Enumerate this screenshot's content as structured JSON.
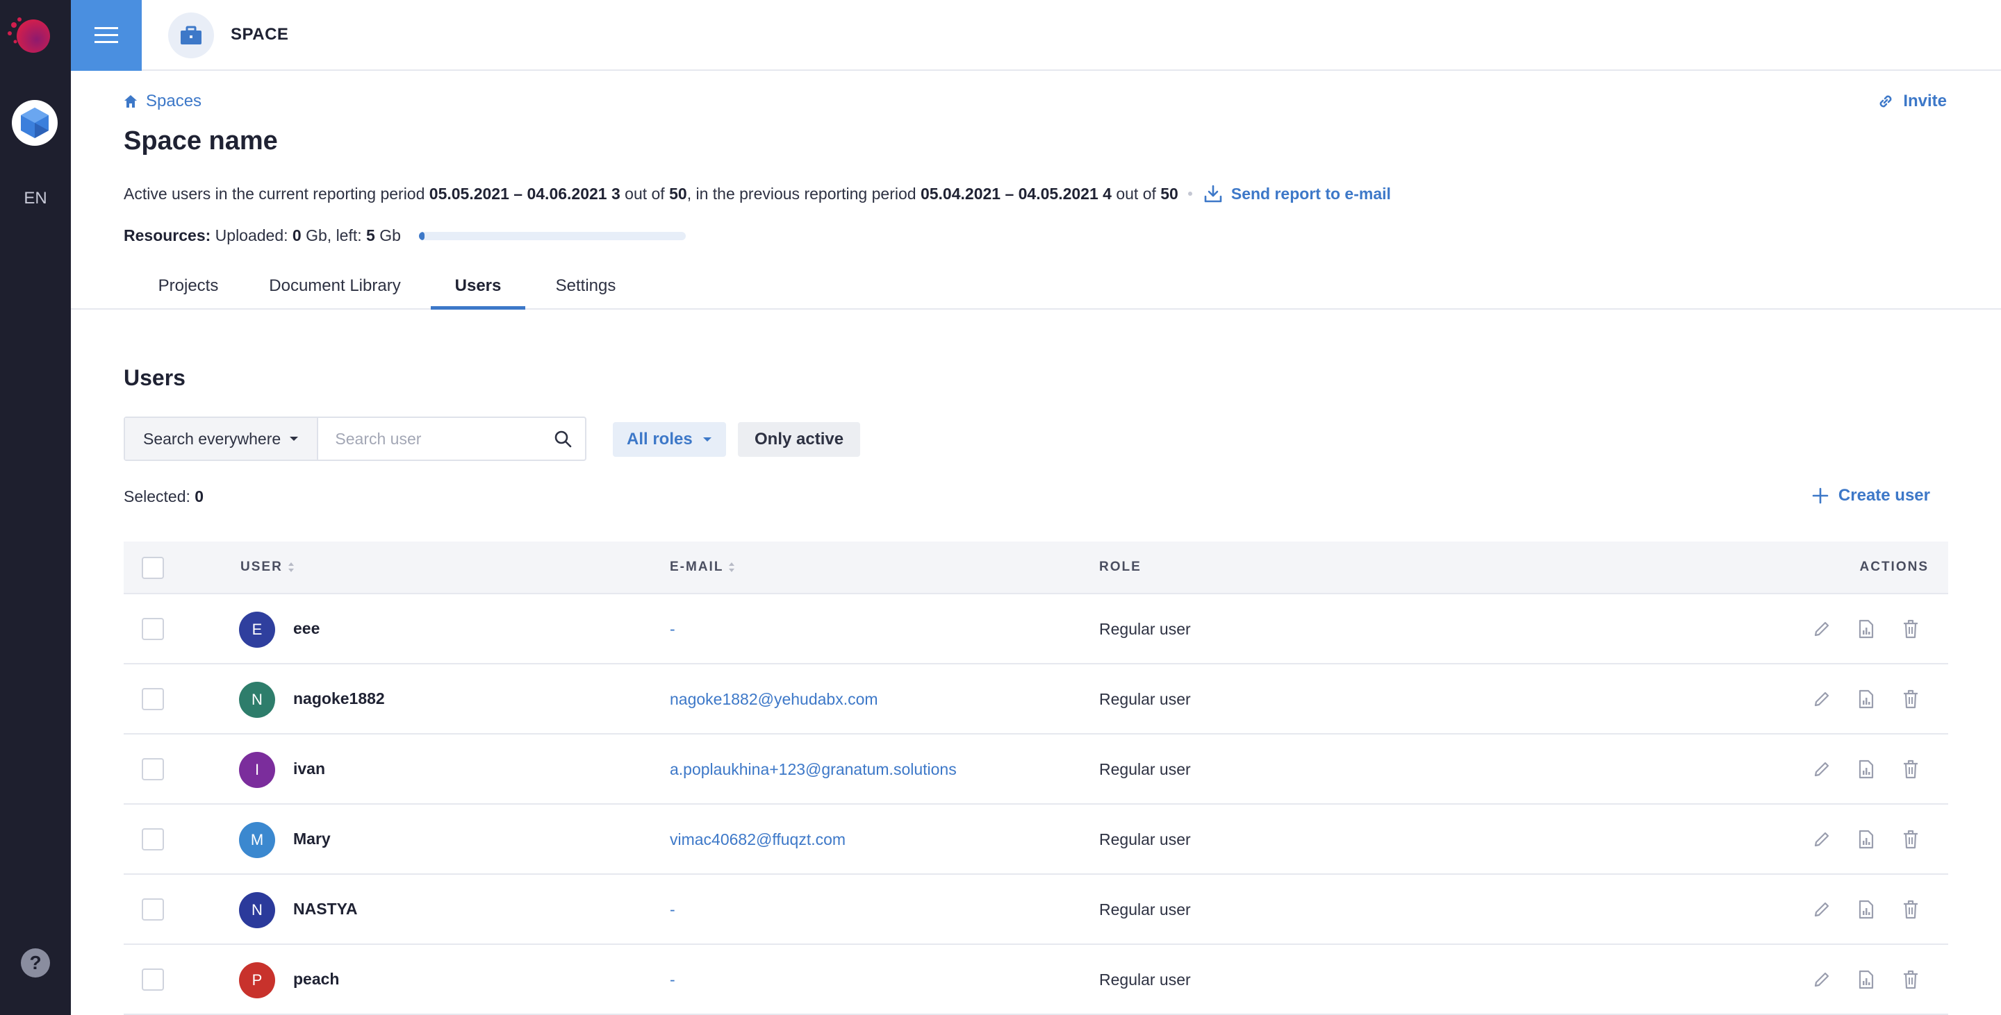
{
  "rail": {
    "lang": "EN",
    "help": "?"
  },
  "topbar": {
    "space_title": "SPACE"
  },
  "breadcrumb": {
    "label": "Spaces"
  },
  "invite_label": "Invite",
  "page_title": "Space name",
  "activity": {
    "prefix": "Active users in the current reporting period",
    "current_period": "05.05.2021 – 04.06.2021",
    "current_count": "3",
    "out_of_1": "out of",
    "current_limit": "50",
    "middle": ", in the previous reporting period",
    "previous_period": "05.04.2021 – 04.05.2021",
    "previous_count": "4",
    "out_of_2": "out of",
    "previous_limit": "50",
    "send_report": "Send report to e-mail"
  },
  "resources": {
    "label": "Resources:",
    "uploaded_label": "Uploaded:",
    "uploaded_value": "0",
    "uploaded_unit": "Gb, left:",
    "left_value": "5",
    "left_unit": "Gb",
    "used_fraction": 0.02
  },
  "tabs": [
    {
      "label": "Projects"
    },
    {
      "label": "Document Library"
    },
    {
      "label": "Users",
      "active": true
    },
    {
      "label": "Settings"
    }
  ],
  "users_section": {
    "title": "Users",
    "scope_select": "Search everywhere",
    "search_placeholder": "Search user",
    "roles_filter": "All roles",
    "only_active": "Only active",
    "selected_label": "Selected:",
    "selected_count": "0",
    "create_user": "Create user"
  },
  "table": {
    "headers": {
      "user": "USER",
      "email": "E-MAIL",
      "role": "ROLE",
      "actions": "ACTIONS"
    },
    "rows": [
      {
        "initial": "E",
        "name": "eee",
        "email": "-",
        "role": "Regular user",
        "color": "#2f3f9e"
      },
      {
        "initial": "N",
        "name": "nagoke1882",
        "email": "nagoke1882@yehudabx.com",
        "role": "Regular user",
        "color": "#2e7d6b"
      },
      {
        "initial": "I",
        "name": "ivan",
        "email": "a.poplaukhina+123@granatum.solutions",
        "role": "Regular user",
        "color": "#7b2d9c"
      },
      {
        "initial": "M",
        "name": "Mary",
        "email": "vimac40682@ffuqzt.com",
        "role": "Regular user",
        "color": "#3b88cf"
      },
      {
        "initial": "N",
        "name": "NASTYA",
        "email": "-",
        "role": "Regular user",
        "color": "#2b3a9b"
      },
      {
        "initial": "P",
        "name": "peach",
        "email": "-",
        "role": "Regular user",
        "color": "#c8322c"
      }
    ]
  },
  "colors": {
    "accent": "#3d78c8",
    "rail": "#1e1f2e",
    "menu_button": "#4a8fe0"
  },
  "icons": [
    "menu-icon",
    "briefcase-icon",
    "home-icon",
    "link-icon",
    "download-icon",
    "chevron-down-icon",
    "search-icon",
    "plus-icon",
    "sort-icon",
    "edit-icon",
    "report-icon",
    "trash-icon",
    "help-icon"
  ]
}
